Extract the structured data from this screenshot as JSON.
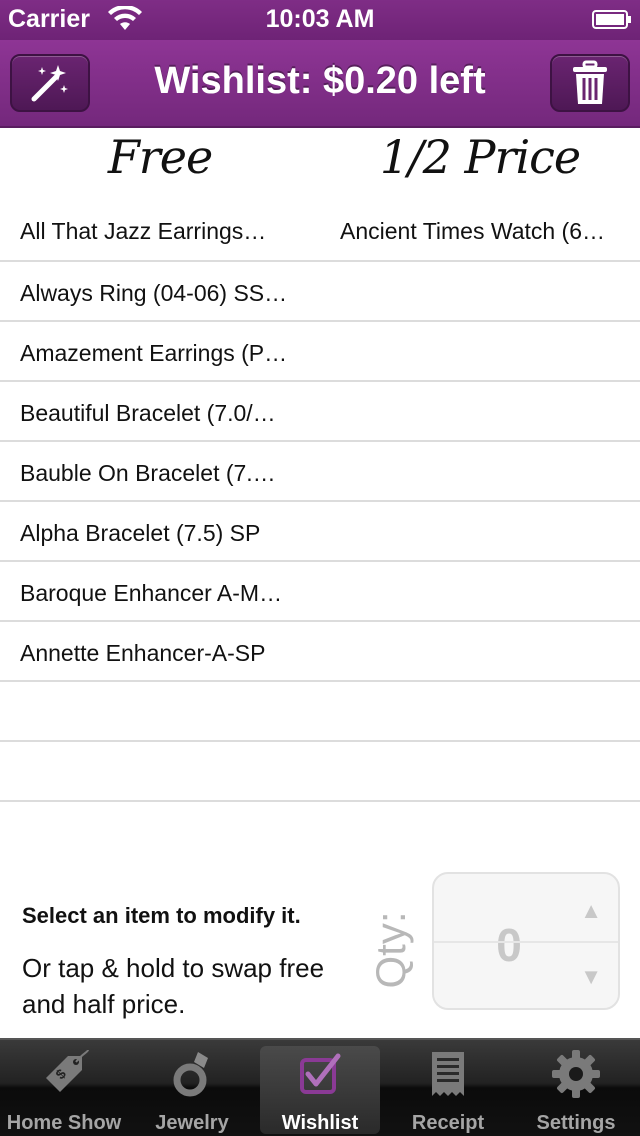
{
  "status_bar": {
    "carrier": "Carrier",
    "time": "10:03 AM"
  },
  "nav": {
    "title": "Wishlist: $0.20 left",
    "left_icon": "magic-wand-icon",
    "right_icon": "trash-icon"
  },
  "columns": {
    "free": "Free",
    "half": "1/2 Price"
  },
  "rows": [
    {
      "free": "All That Jazz Earrings…",
      "half": "Ancient Times Watch (6…"
    },
    {
      "free": "Always Ring (04-06) SS…",
      "half": ""
    },
    {
      "free": "Amazement Earrings (P…",
      "half": ""
    },
    {
      "free": "Beautiful Bracelet (7.0/…",
      "half": ""
    },
    {
      "free": "Bauble On Bracelet (7.…",
      "half": ""
    },
    {
      "free": "Alpha Bracelet (7.5) SP",
      "half": ""
    },
    {
      "free": "Baroque Enhancer A-M…",
      "half": ""
    },
    {
      "free": "Annette Enhancer-A-SP",
      "half": ""
    },
    {
      "free": "",
      "half": ""
    },
    {
      "free": "",
      "half": ""
    }
  ],
  "info": {
    "bold": "Select an item to modify it.",
    "text": "Or tap & hold to swap free and half price."
  },
  "qty": {
    "label": "Qty:",
    "value": "0",
    "up": "▲",
    "down": "▼"
  },
  "tabs": [
    {
      "label": "Home Show",
      "icon": "price-tag-icon",
      "active": false
    },
    {
      "label": "Jewelry",
      "icon": "ring-icon",
      "active": false
    },
    {
      "label": "Wishlist",
      "icon": "checkbox-icon",
      "active": true
    },
    {
      "label": "Receipt",
      "icon": "receipt-icon",
      "active": false
    },
    {
      "label": "Settings",
      "icon": "gear-icon",
      "active": false
    }
  ],
  "colors": {
    "brand_purple": "#7f2d86",
    "tab_bar": "#1a1a1a",
    "active_tab_icon": "#8a3a95"
  }
}
